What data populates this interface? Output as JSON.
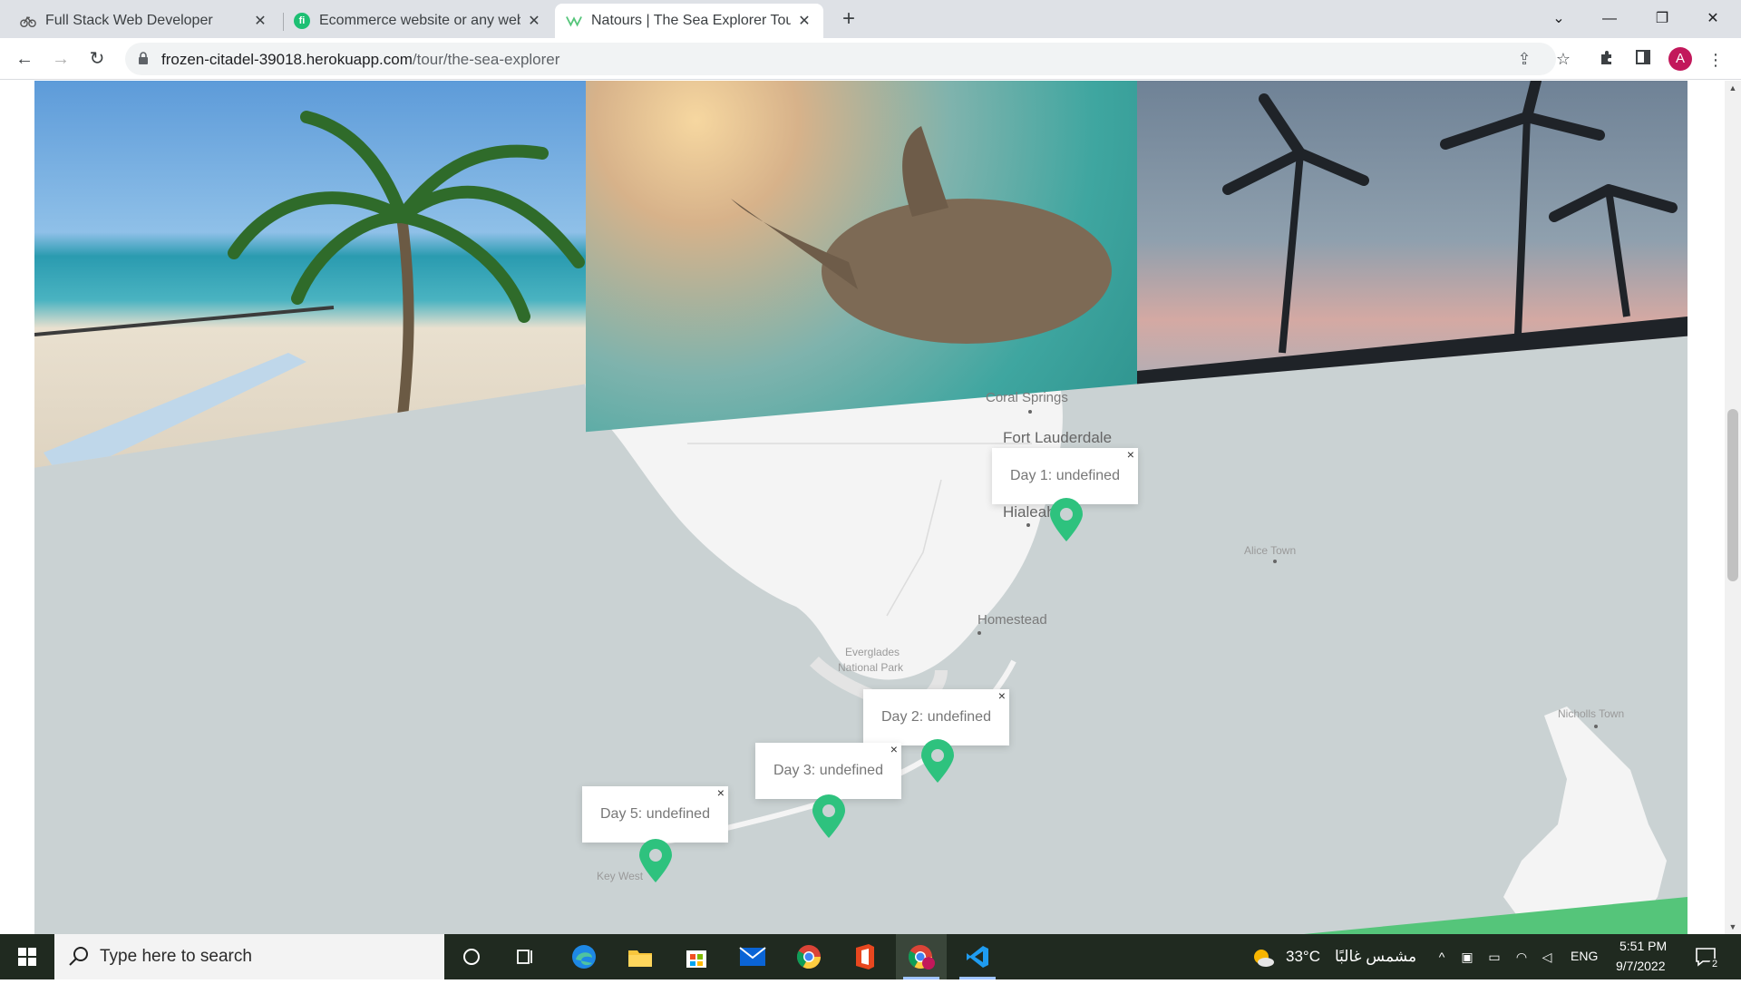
{
  "browser": {
    "tabs": [
      {
        "title": "Full Stack Web Developer",
        "favicon": "bike-icon",
        "active": false
      },
      {
        "title": "Ecommerce website or any websi",
        "favicon": "fiverr-icon",
        "active": false
      },
      {
        "title": "Natours | The Sea Explorer Tour",
        "favicon": "natours-icon",
        "active": true
      }
    ],
    "new_tab_symbol": "+",
    "address": {
      "host": "frozen-citadel-39018.herokuapp.com",
      "path": "/tour/the-sea-explorer"
    },
    "profile_initial": "A"
  },
  "map": {
    "places": [
      {
        "name": "Coral Springs",
        "size": "normal"
      },
      {
        "name": "Fort Lauderdale",
        "size": "big"
      },
      {
        "name": "Hialeah",
        "size": "big"
      },
      {
        "name": "Alice Town",
        "size": "small"
      },
      {
        "name": "Homestead",
        "size": "normal"
      },
      {
        "name": "Everglades",
        "size": "small"
      },
      {
        "name": "National Park",
        "size": "small"
      },
      {
        "name": "Nicholls Town",
        "size": "small"
      },
      {
        "name": "Key West",
        "size": "small"
      }
    ],
    "popups": [
      {
        "text": "Day 1: undefined",
        "close": "×"
      },
      {
        "text": "Day 2: undefined",
        "close": "×"
      },
      {
        "text": "Day 3: undefined",
        "close": "×"
      },
      {
        "text": "Day 5: undefined",
        "close": "×"
      }
    ],
    "pin_color": "#2ec27e"
  },
  "taskbar": {
    "search_placeholder": "Type here to search",
    "weather_temp": "33°C",
    "weather_text": "مشمس غالبًا",
    "language": "ENG",
    "time": "5:51 PM",
    "date": "9/7/2022",
    "notification_count": "2"
  },
  "colors": {
    "accent_green": "#55c57a",
    "map_water": "#cad2d3",
    "map_land": "#f4f4f4"
  }
}
